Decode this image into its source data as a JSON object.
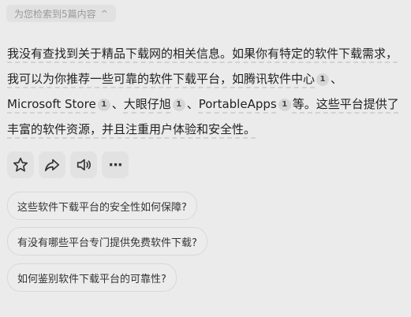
{
  "search_summary": {
    "label": "为您检索到5篇内容",
    "chevron": "^"
  },
  "answer": {
    "seg1": "我没有查找到关于精品下载网的相关信息。如果你有特定的软件下载需求，我可以为你推荐一些可靠的软件下载平台，如腾讯软件中心",
    "cite1": "1",
    "sep1": "、",
    "seg2": "Microsoft Store",
    "cite2": "1",
    "sep2": "、",
    "seg3": "大眼仔旭",
    "cite3": "1",
    "sep3": "、",
    "seg4": "PortableApps",
    "cite4": "1",
    "seg5": "等。这些平台提供了丰富的软件资源，并且注重用户体验和安全性。"
  },
  "actions": {
    "items": [
      "star-icon",
      "share-icon",
      "speaker-icon",
      "more-icon"
    ],
    "more_label": "···"
  },
  "suggestions": [
    "这些软件下载平台的安全性如何保障?",
    "有没有哪些平台专门提供免费软件下载?",
    "如何鉴别软件下载平台的可靠性?"
  ]
}
